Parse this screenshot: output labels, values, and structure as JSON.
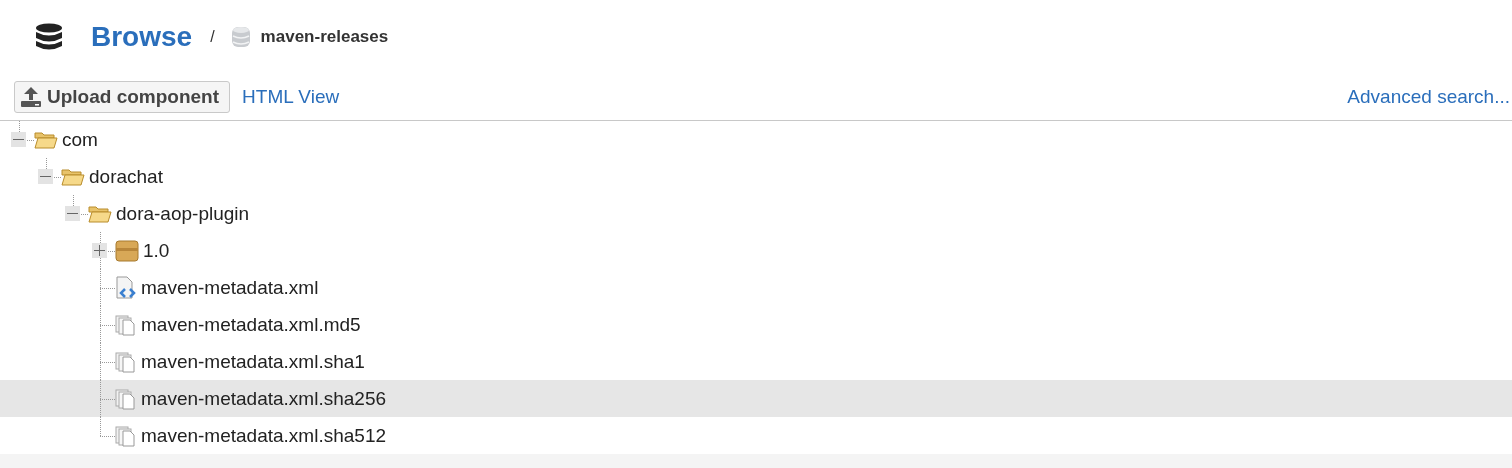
{
  "header": {
    "title": "Browse",
    "separator": "/",
    "repository": "maven-releases"
  },
  "toolbar": {
    "upload_button": "Upload component",
    "html_view_link": "HTML View",
    "advanced_search_link": "Advanced search..."
  },
  "tree": [
    {
      "label": "com",
      "kind": "folder",
      "expanded": true,
      "selected": false,
      "children": [
        {
          "label": "dorachat",
          "kind": "folder",
          "expanded": true,
          "selected": false,
          "children": [
            {
              "label": "dora-aop-plugin",
              "kind": "folder",
              "expanded": true,
              "selected": false,
              "children": [
                {
                  "label": "1.0",
                  "kind": "package",
                  "expanded": false,
                  "selected": false
                },
                {
                  "label": "maven-metadata.xml",
                  "kind": "xml",
                  "selected": false
                },
                {
                  "label": "maven-metadata.xml.md5",
                  "kind": "file",
                  "selected": false
                },
                {
                  "label": "maven-metadata.xml.sha1",
                  "kind": "file",
                  "selected": false
                },
                {
                  "label": "maven-metadata.xml.sha256",
                  "kind": "file",
                  "selected": true
                },
                {
                  "label": "maven-metadata.xml.sha512",
                  "kind": "file",
                  "selected": false
                }
              ]
            }
          ]
        }
      ]
    }
  ]
}
